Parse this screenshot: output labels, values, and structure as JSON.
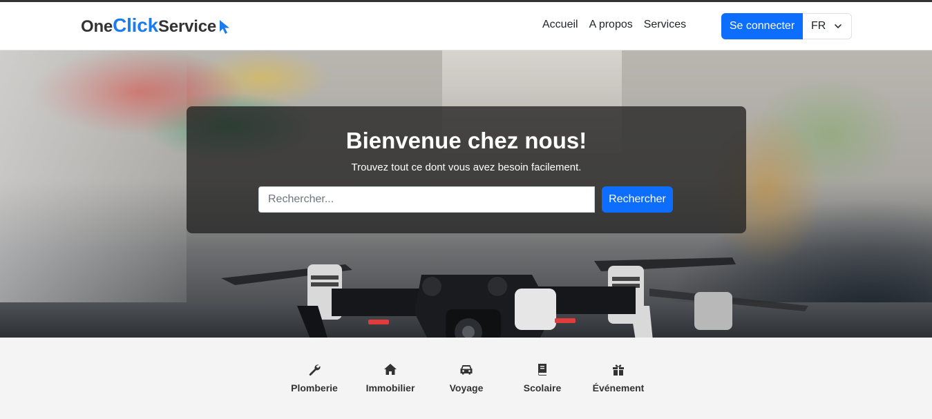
{
  "brand": {
    "part1": "One",
    "part2": "Click",
    "part3": "Service"
  },
  "nav": {
    "links": [
      {
        "label": "Accueil"
      },
      {
        "label": "A propos"
      },
      {
        "label": "Services"
      }
    ],
    "login_label": "Se connecter",
    "language": "FR"
  },
  "hero": {
    "title": "Bienvenue chez nous!",
    "subtitle": "Trouvez tout ce dont vous avez besoin facilement.",
    "search": {
      "placeholder": "Rechercher...",
      "value": "",
      "button_label": "Rechercher"
    }
  },
  "categories": [
    {
      "label": "Plomberie",
      "icon": "wrench-icon"
    },
    {
      "label": "Immobilier",
      "icon": "house-icon"
    },
    {
      "label": "Voyage",
      "icon": "car-icon"
    },
    {
      "label": "Scolaire",
      "icon": "book-icon"
    },
    {
      "label": "Événement",
      "icon": "gift-icon"
    }
  ],
  "colors": {
    "accent": "#0d6efd",
    "brand_blue": "#1a7cf0",
    "card_overlay": "#222222"
  }
}
